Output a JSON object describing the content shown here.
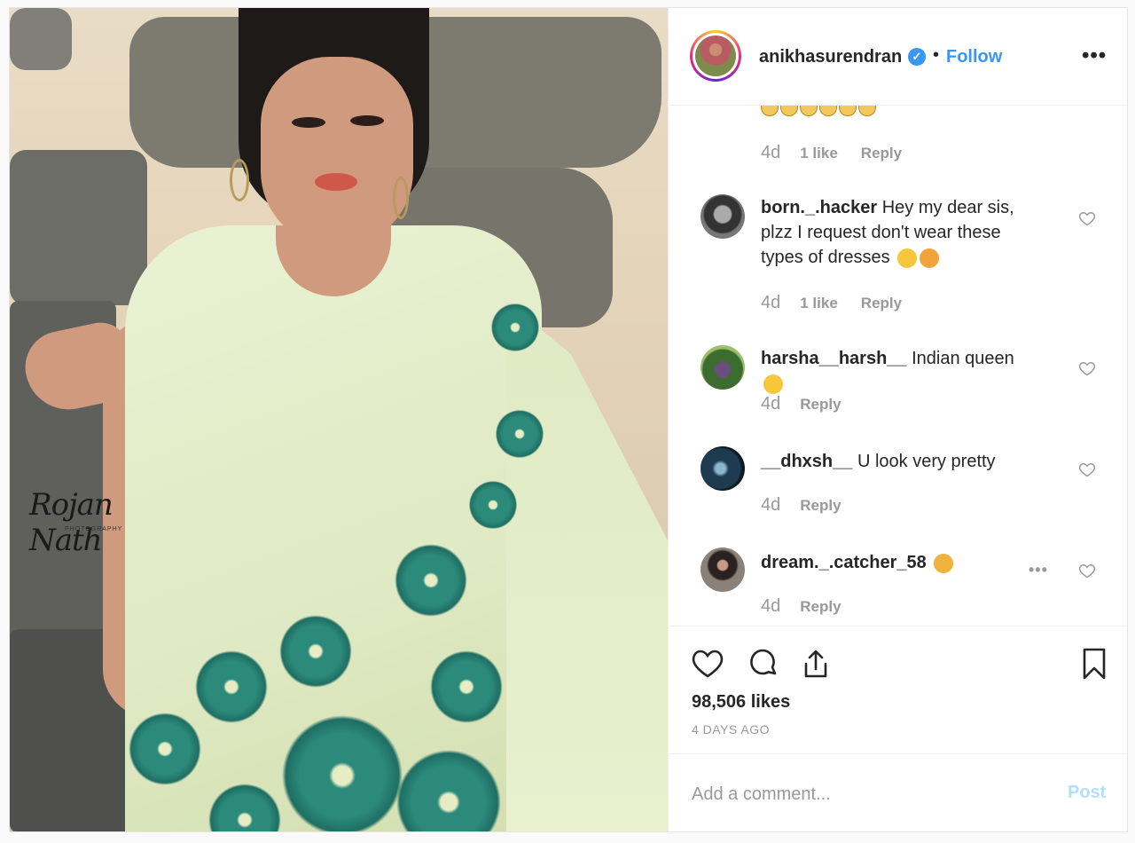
{
  "post": {
    "username": "anikhasurendran",
    "separator": "•",
    "follow_label": "Follow",
    "more_label": "•••",
    "verified_mark": "✓",
    "watermark": {
      "name": "Rojan Nath",
      "subtitle": "PHOTOGRAPHY"
    }
  },
  "comments": [
    {
      "user": "",
      "text": "",
      "time": "4d",
      "likes": "1 like",
      "reply": "Reply",
      "partial": true
    },
    {
      "user": "born._.hacker",
      "text": "Hey my dear sis, plzz I request don't wear these types of dresses",
      "emoji": [
        "laughing-face",
        "tongue-face"
      ],
      "time": "4d",
      "likes": "1 like",
      "reply": "Reply"
    },
    {
      "user": "harsha__harsh__",
      "text": "Indian queen",
      "emoji": [
        "crown-face"
      ],
      "time": "4d",
      "likes": "",
      "reply": "Reply"
    },
    {
      "user": "__dhxsh__",
      "text": "U look very pretty",
      "time": "4d",
      "likes": "",
      "reply": "Reply"
    },
    {
      "user": "dream._.catcher_58",
      "text": "",
      "emoji": [
        "heart-eyes-face"
      ],
      "time": "4d",
      "likes": "",
      "reply": "Reply",
      "more": "•••"
    }
  ],
  "actions": {
    "likes": "98,506 likes",
    "ago": "4 DAYS AGO"
  },
  "add_comment": {
    "placeholder": "Add a comment...",
    "post_label": "Post"
  },
  "colors": {
    "accent": "#3897f0",
    "post_disabled": "#b2dffc",
    "meta": "#999999"
  }
}
